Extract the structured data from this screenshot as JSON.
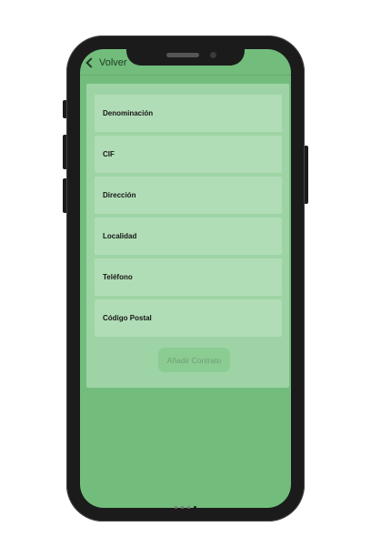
{
  "topbar": {
    "back_label": "Volver"
  },
  "form": {
    "fields": [
      {
        "label": "Denominación"
      },
      {
        "label": "CIF"
      },
      {
        "label": "Dirección"
      },
      {
        "label": "Localidad"
      },
      {
        "label": "Teléfono"
      },
      {
        "label": "Código Postal"
      }
    ],
    "submit_label": "Añadir Contrato"
  },
  "theme": {
    "screen_bg": "#72bd7c",
    "card_bg": "#9ed4a5",
    "field_bg": "#b1ddb6",
    "button_bg": "#8bcc93"
  },
  "pager": {
    "count": 4,
    "active": 4
  }
}
